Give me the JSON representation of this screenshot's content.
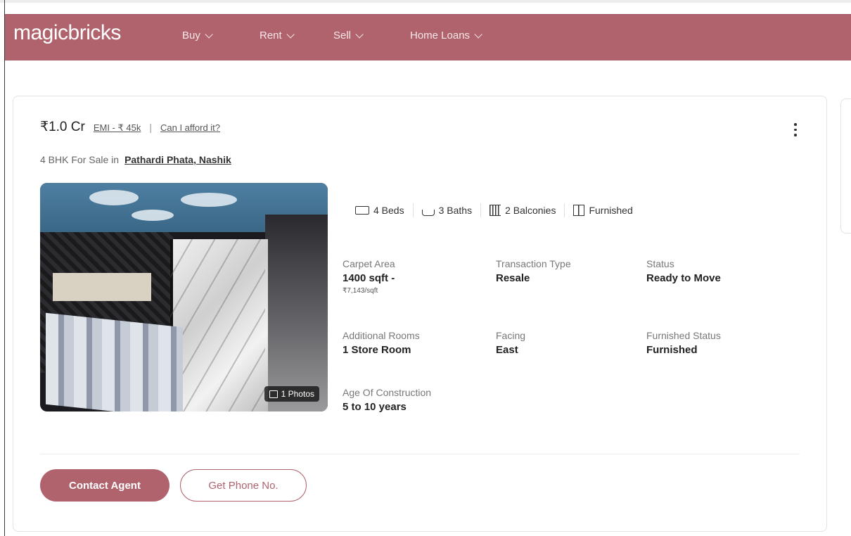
{
  "brand": {
    "logo": "magicbricks",
    "accent": "#b0636d"
  },
  "nav": [
    {
      "label": "Buy"
    },
    {
      "label": "Rent"
    },
    {
      "label": "Sell"
    },
    {
      "label": "Home Loans"
    }
  ],
  "listing": {
    "price": "₹1.0 Cr",
    "emi": "EMI - ₹ 45k",
    "separator": "|",
    "afford": "Can I afford it?",
    "type": "4 BHK For Sale in",
    "location": "Pathardi Phata, Nashik",
    "photos_badge": "1 Photos",
    "amenities": [
      {
        "icon": "bed-icon",
        "label": "4 Beds"
      },
      {
        "icon": "bath-icon",
        "label": "3 Baths"
      },
      {
        "icon": "balcony-icon",
        "label": "2 Balconies"
      },
      {
        "icon": "furnished-icon",
        "label": "Furnished"
      }
    ],
    "details": {
      "carpet_area": {
        "label": "Carpet Area",
        "value": "1400 sqft -",
        "sub": "₹7,143/sqft"
      },
      "transaction_type": {
        "label": "Transaction Type",
        "value": "Resale"
      },
      "status": {
        "label": "Status",
        "value": "Ready to Move"
      },
      "additional_rooms": {
        "label": "Additional Rooms",
        "value": "1 Store Room"
      },
      "facing": {
        "label": "Facing",
        "value": "East"
      },
      "furnished_status": {
        "label": "Furnished Status",
        "value": "Furnished"
      },
      "age": {
        "label": "Age Of Construction",
        "value": "5 to 10 years"
      }
    },
    "actions": {
      "contact": "Contact Agent",
      "phone": "Get Phone No."
    }
  }
}
